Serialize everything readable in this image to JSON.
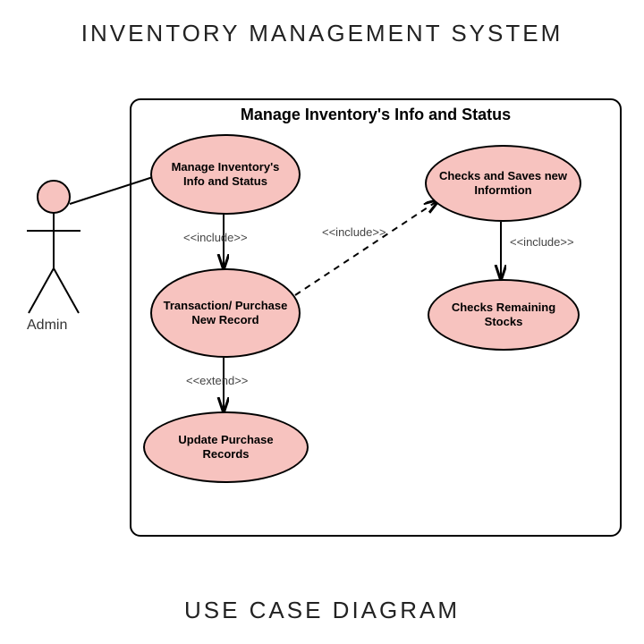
{
  "title": "INVENTORY MANAGEMENT SYSTEM",
  "footer": "USE CASE DIAGRAM",
  "actor": {
    "name": "Admin"
  },
  "system": {
    "title": "Manage Inventory's Info and Status"
  },
  "use_cases": {
    "uc1": "Manage Inventory's Info and Status",
    "uc2": "Transaction/ Purchase New Record",
    "uc3": "Update Purchase Records",
    "uc4": "Checks and Saves new Informtion",
    "uc5": "Checks Remaining Stocks"
  },
  "relations": {
    "r_uc1_uc2": "<<include>>",
    "r_uc2_uc4": "<<include>>",
    "r_uc4_uc5": "<<include>>",
    "r_uc2_uc3": "<<extend>>"
  }
}
